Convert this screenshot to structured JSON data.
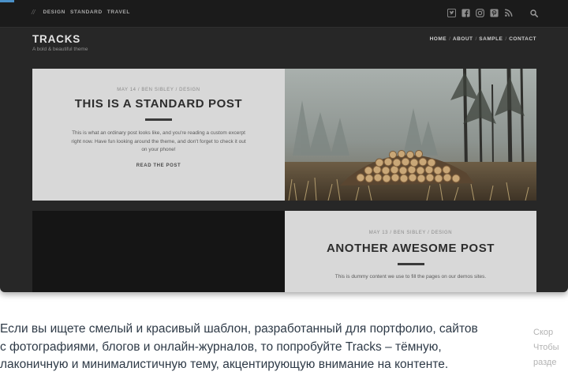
{
  "topbar": {
    "categories": [
      "DESIGN",
      "STANDARD",
      "TRAVEL"
    ],
    "social_icons": [
      "twitter-icon",
      "facebook-icon",
      "instagram-icon",
      "pinterest-icon",
      "rss-icon"
    ],
    "search_icon": "search-icon"
  },
  "site": {
    "title": "TRACKS",
    "tagline": "A bold & beautiful theme"
  },
  "nav": {
    "items": [
      "HOME",
      "ABOUT",
      "SAMPLE",
      "CONTACT"
    ],
    "separator": "/"
  },
  "posts": [
    {
      "meta": "MAY 14 / BEN SIBLEY / DESIGN",
      "title": "THIS IS A STANDARD POST",
      "excerpt": "This is what an ordinary post looks like, and you're reading a custom excerpt right now. Have fun looking around the theme, and don't forget to check it out on your phone!",
      "read_more": "READ THE POST"
    },
    {
      "meta": "MAY 13 / BEN SIBLEY / DESIGN",
      "title": "ANOTHER AWESOME POST",
      "excerpt": "This is dummy content we use to fill the pages on our demos sites."
    }
  ],
  "article": {
    "lines": [
      "Если вы ищете смелый и красивый шаблон, разработанный для портфолио, сайтов",
      "с фотографиями, блогов и онлайн-журналов, то попробуйте Tracks – тёмную,",
      "лаконичную и минималистичную тему, акцентирующую внимание на контенте."
    ]
  },
  "side_hint": {
    "lines": [
      "Скор",
      "Чтобы",
      "разде"
    ]
  },
  "colors": {
    "page_background": "#272727",
    "card_background": "#d8d8d8",
    "accent_mark": "#4a90c8"
  }
}
